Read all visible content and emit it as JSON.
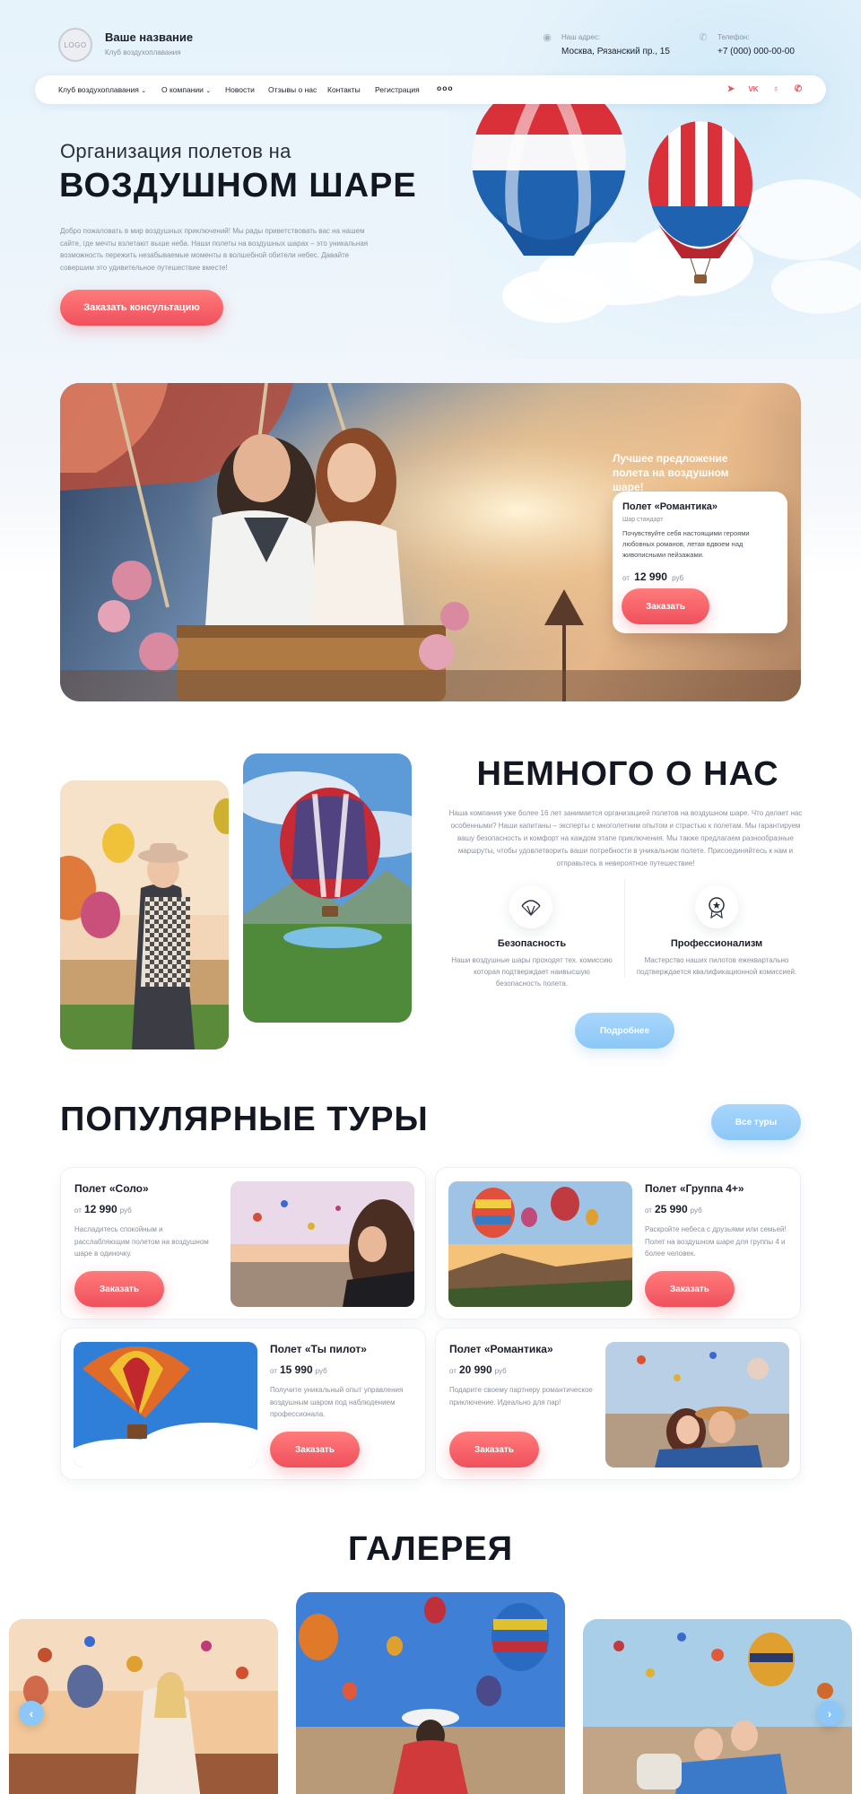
{
  "header": {
    "logo_text": "LOGO",
    "brand_name": "Ваше название",
    "brand_sub": "Клуб воздухоплавания",
    "address_label": "Наш адрес:",
    "address_value": "Москва, Рязанский пр., 15",
    "phone_label": "Телефон:",
    "phone_value": "+7 (000) 000-00-00"
  },
  "nav": {
    "items": [
      "Клуб воздухоплавания",
      "О компании",
      "Новости",
      "Отзывы о нас",
      "Контакты",
      "Регистрация"
    ],
    "more": "ooo",
    "socials": [
      "telegram-icon",
      "vk-icon",
      "ok-icon",
      "whatsapp-icon"
    ]
  },
  "hero": {
    "subtitle": "Организация полетов на",
    "title": "ВОЗДУШНОМ ШАРЕ",
    "text": "Добро пожаловать в мир воздушных приключений! Мы рады приветствовать вас на нашем сайте, где мечты взлетают выше неба. Наши полеты на воздушных шарах – это уникальная возможность пережить незабываемые моменты в волшебной обители небес. Давайте совершим это удивительное путешествие вместе!",
    "cta": "Заказать консультацию"
  },
  "offer": {
    "headline": "Лучшее предложение полета на воздушном шаре!",
    "card_title": "Полет «Романтика»",
    "card_sub": "Шар стандарт",
    "card_text": "Почувствуйте себя настоящими героями любовных романов, летая вдвоем над живописными пейзажами.",
    "price_from": "от",
    "price": "12 990",
    "currency": "руб",
    "button": "Заказать"
  },
  "about": {
    "title": "НЕМНОГО О НАС",
    "text": "Наша компания уже более 16 лет занимается организацией полетов на воздушном шаре. Что делает нас особенными? Наши капитаны – эксперты с многолетним опытом и страстью к полетам. Мы гарантируем вашу безопасность и комфорт на каждом этапе приключения. Мы также предлагаем разнообразные маршруты, чтобы удовлетворить ваши потребности в уникальном полете. Присоединяйтесь к нам и отправьтесь в невероятное путешествие!",
    "features": [
      {
        "icon": "parachute-icon",
        "title": "Безопасность",
        "text": "Наши воздушные шары проходят тех. комиссию которая подтверждает наивысшую безопасность полета."
      },
      {
        "icon": "award-badge-icon",
        "title": "Профессионализм",
        "text": "Мастерство наших пилотов ежеквартально подтверждается квалификационной комиссией."
      }
    ],
    "button": "Подробнее"
  },
  "tours": {
    "title": "ПОПУЛЯРНЫЕ ТУРЫ",
    "all_button": "Все туры",
    "items": [
      {
        "name": "Полет «Соло»",
        "from": "от",
        "price": "12 990",
        "currency": "руб",
        "desc": "Насладитесь спокойным и расслабляющим полетом на воздушном шаре в одиночку.",
        "button": "Заказать"
      },
      {
        "name": "Полет «Группа 4+»",
        "from": "от",
        "price": "25 990",
        "currency": "руб",
        "desc": "Раскройте небеса с друзьями или семьей! Полет на воздушном шаре для группы 4 и более человек.",
        "button": "Заказать"
      },
      {
        "name": "Полет «Ты пилот»",
        "from": "от",
        "price": "15 990",
        "currency": "руб",
        "desc": "Получите уникальный опыт управления воздушным шаром под наблюдением профессионала.",
        "button": "Заказать"
      },
      {
        "name": "Полет «Романтика»",
        "from": "от",
        "price": "20 990",
        "currency": "руб",
        "desc": "Подарите своему партнеру романтическое приключение. Идеально для пар!",
        "button": "Заказать"
      }
    ]
  },
  "gallery": {
    "title": "ГАЛЕРЕЯ",
    "prev": "‹",
    "next": "›"
  }
}
